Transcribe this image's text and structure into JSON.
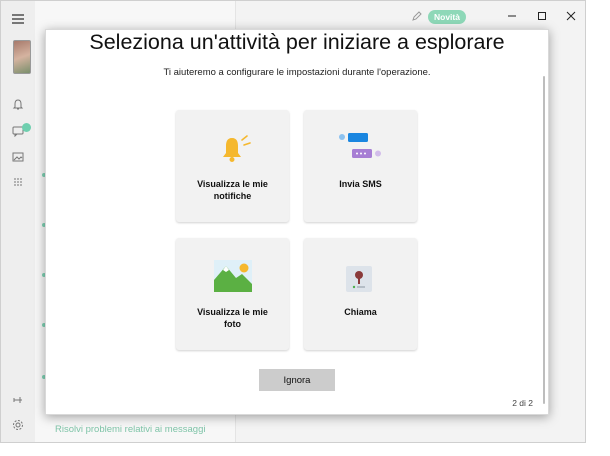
{
  "app": {
    "novita_badge": "Novità",
    "bottom_link": "Risolvi problemi relativi ai messaggi"
  },
  "dialog": {
    "title": "Seleziona un'attività per iniziare a esplorare",
    "subtitle": "Ti aiuteremo a configurare le impostazioni durante l'operazione.",
    "tiles": [
      {
        "label_line1": "Visualizza le mie",
        "label_line2": "notifiche",
        "icon": "bell-icon"
      },
      {
        "label_line1": "Invia SMS",
        "label_line2": "",
        "icon": "chat-bubbles-icon"
      },
      {
        "label_line1": "Visualizza le mie",
        "label_line2": "foto",
        "icon": "photo-landscape-icon"
      },
      {
        "label_line1": "Chiama",
        "label_line2": "",
        "icon": "phone-contact-icon"
      }
    ],
    "ignore_button": "Ignora",
    "page_indicator": "2 di 2"
  },
  "colors": {
    "accent_green": "#8ed8b8",
    "bell_yellow": "#f5b82e",
    "chat_blue": "#1a86e0",
    "chat_purple": "#a77ed4",
    "button_gray": "#cccccc"
  }
}
